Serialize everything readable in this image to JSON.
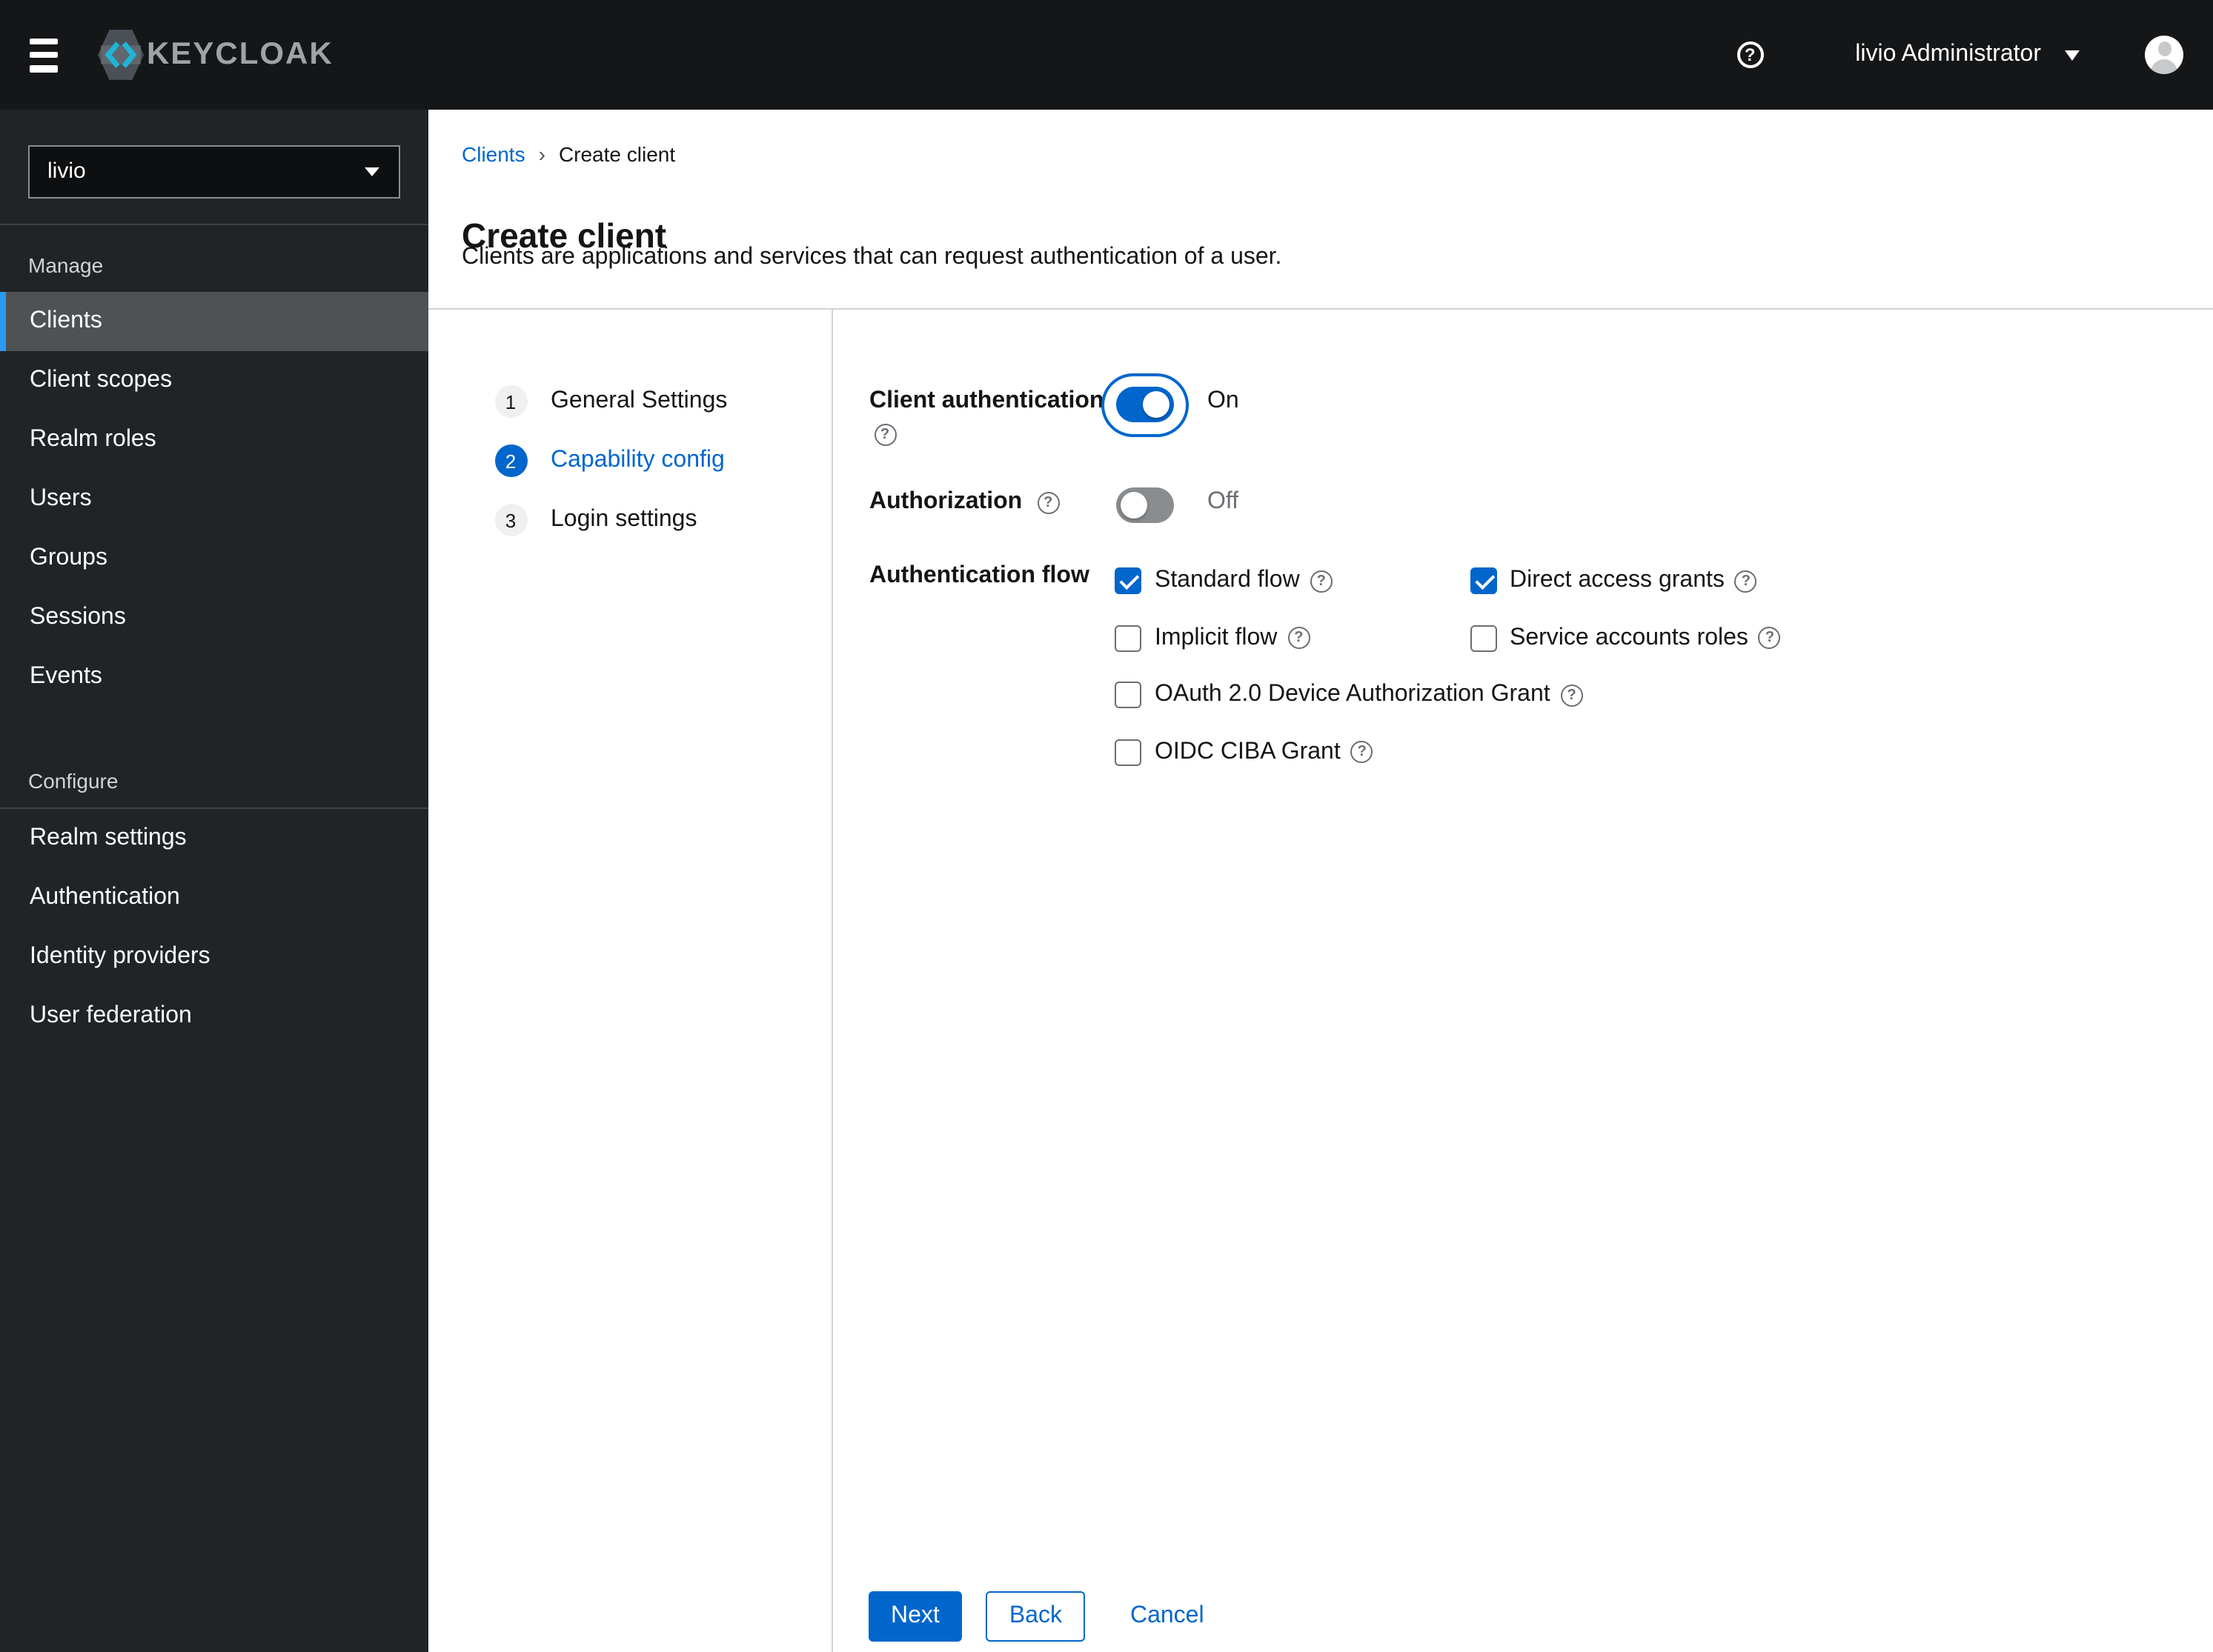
{
  "masthead": {
    "brand": "KEYCLOAK",
    "user": "livio Administrator"
  },
  "sidebar": {
    "realm": "livio",
    "manage": {
      "title": "Manage",
      "items": [
        "Clients",
        "Client scopes",
        "Realm roles",
        "Users",
        "Groups",
        "Sessions",
        "Events"
      ]
    },
    "configure": {
      "title": "Configure",
      "items": [
        "Realm settings",
        "Authentication",
        "Identity providers",
        "User federation"
      ]
    },
    "active_item": "Clients"
  },
  "breadcrumb": {
    "parent": "Clients",
    "current": "Create client"
  },
  "page": {
    "title": "Create client",
    "subtitle": "Clients are applications and services that can request authentication of a user."
  },
  "wizard": {
    "steps": [
      {
        "num": "1",
        "label": "General Settings",
        "active": false
      },
      {
        "num": "2",
        "label": "Capability config",
        "active": true
      },
      {
        "num": "3",
        "label": "Login settings",
        "active": false
      }
    ]
  },
  "form": {
    "client_authentication": {
      "label": "Client authentication",
      "state": "On",
      "enabled": true
    },
    "authorization": {
      "label": "Authorization",
      "state": "Off",
      "enabled": false
    },
    "authentication_flow": {
      "label": "Authentication flow",
      "options": [
        {
          "label": "Standard flow",
          "checked": true
        },
        {
          "label": "Direct access grants",
          "checked": true
        },
        {
          "label": "Implicit flow",
          "checked": false
        },
        {
          "label": "Service accounts roles",
          "checked": false
        },
        {
          "label": "OAuth 2.0 Device Authorization Grant",
          "checked": false
        },
        {
          "label": "OIDC CIBA Grant",
          "checked": false
        }
      ]
    }
  },
  "footer": {
    "next": "Next",
    "back": "Back",
    "cancel": "Cancel"
  },
  "icons": {
    "help": "?",
    "breadcrumb_separator": "›"
  },
  "colors": {
    "accent": "#0066cc",
    "nav_active_indicator": "#2b9af3",
    "masthead_bg": "#141618",
    "sidebar_bg": "#212427",
    "switch_off": "#8a8d90",
    "logo_cyan": "#1fb5d8"
  }
}
